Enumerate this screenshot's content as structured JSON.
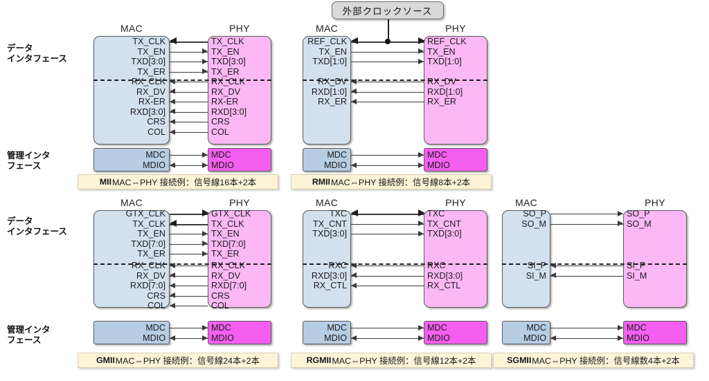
{
  "side_labels": {
    "data_interface": "データ\nインタフェース",
    "mgmt_interface": "管理インタ\nフェース"
  },
  "headers": {
    "mac": "MAC",
    "phy": "PHY"
  },
  "external_clock": {
    "label": "外部クロックソース"
  },
  "colors": {
    "mac_fill": "#d3e1ef",
    "phy_fill": "#fbb8f5",
    "mgmt_mac_fill": "#b7cde4",
    "mgmt_phy_fill": "#f45ff0",
    "caption_fill": "#fdf3d7",
    "clock_fill": "#d9d9d9",
    "wire": "#3a3a3a"
  },
  "panels": [
    {
      "id": "mii",
      "caption_name": "MII",
      "caption_rest": " MAC⇔PHY 接続例：信号線16本+2本",
      "tx_signals": [
        {
          "name": "TX_CLK",
          "dir": "left"
        },
        {
          "name": "TX_EN",
          "dir": "right"
        },
        {
          "name": "TXD[3:0]",
          "dir": "right"
        },
        {
          "name": "TX_ER",
          "dir": "right"
        }
      ],
      "rx_signals": [
        {
          "name": "RX_CLK",
          "dir": "left"
        },
        {
          "name": "RX_DV",
          "dir": "left"
        },
        {
          "name": "RX-ER",
          "dir": "left"
        },
        {
          "name": "RXD[3:0]",
          "dir": "left"
        },
        {
          "name": "CRS",
          "dir": "left"
        },
        {
          "name": "COL",
          "dir": "left"
        }
      ],
      "mgmt_signals": [
        {
          "name": "MDC",
          "dir": "right"
        },
        {
          "name": "MDIO",
          "dir": "both"
        }
      ]
    },
    {
      "id": "rmii",
      "caption_name": "RMII",
      "caption_rest": " MAC⇔PHY 接続例：信号線8本+2本",
      "has_external_clock": true,
      "tx_signals": [
        {
          "name": "REF_CLK",
          "dir": "both"
        },
        {
          "name": "TX_EN",
          "dir": "right"
        },
        {
          "name": "TXD[1:0]",
          "dir": "right"
        }
      ],
      "rx_signals": [
        {
          "name": "RX_DV",
          "dir": "left"
        },
        {
          "name": "RXD[1:0]",
          "dir": "left"
        },
        {
          "name": "RX_ER",
          "dir": "left"
        }
      ],
      "mgmt_signals": [
        {
          "name": "MDC",
          "dir": "right"
        },
        {
          "name": "MDIO",
          "dir": "both"
        }
      ]
    },
    {
      "id": "gmii",
      "caption_name": "GMII",
      "caption_rest": " MAC⇔PHY 接続例：信号線24本+2本",
      "tx_signals": [
        {
          "name": "GTX_CLK",
          "dir": "right"
        },
        {
          "name": "TX_CLK",
          "dir": "left"
        },
        {
          "name": "TX_EN",
          "dir": "right"
        },
        {
          "name": "TXD[7:0]",
          "dir": "right"
        },
        {
          "name": "TX_ER",
          "dir": "right"
        }
      ],
      "rx_signals": [
        {
          "name": "RX_CLK",
          "dir": "left"
        },
        {
          "name": "RX_DV",
          "dir": "left"
        },
        {
          "name": "RXD[7:0]",
          "dir": "left"
        },
        {
          "name": "CRS",
          "dir": "left"
        },
        {
          "name": "COL",
          "dir": "left"
        }
      ],
      "mgmt_signals": [
        {
          "name": "MDC",
          "dir": "right"
        },
        {
          "name": "MDIO",
          "dir": "both"
        }
      ]
    },
    {
      "id": "rgmii",
      "caption_name": "RGMII",
      "caption_rest": " MAC⇔PHY 接続例：信号線12本+2本",
      "tx_signals": [
        {
          "name": "TXC",
          "dir": "both"
        },
        {
          "name": "TX_CNT",
          "dir": "right"
        },
        {
          "name": "TXD[3:0]",
          "dir": "right"
        }
      ],
      "rx_signals": [
        {
          "name": "RXC",
          "dir": "left"
        },
        {
          "name": "RXD[3:0]",
          "dir": "left"
        },
        {
          "name": "RX_CTL",
          "dir": "left"
        }
      ],
      "mgmt_signals": [
        {
          "name": "MDC",
          "dir": "right"
        },
        {
          "name": "MDIO",
          "dir": "both"
        }
      ]
    },
    {
      "id": "sgmii",
      "caption_name": "SGMII",
      "caption_rest": " MAC⇔PHY 接続例：信号線数4本+2本",
      "tx_signals": [
        {
          "name": "SO_P",
          "dir": "right"
        },
        {
          "name": "SO_M",
          "dir": "right"
        }
      ],
      "rx_signals": [
        {
          "name": "SI_P",
          "dir": "left"
        },
        {
          "name": "SI_M",
          "dir": "left"
        }
      ],
      "mgmt_signals": [
        {
          "name": "MDC",
          "dir": "right"
        },
        {
          "name": "MDIO",
          "dir": "both"
        }
      ]
    }
  ]
}
